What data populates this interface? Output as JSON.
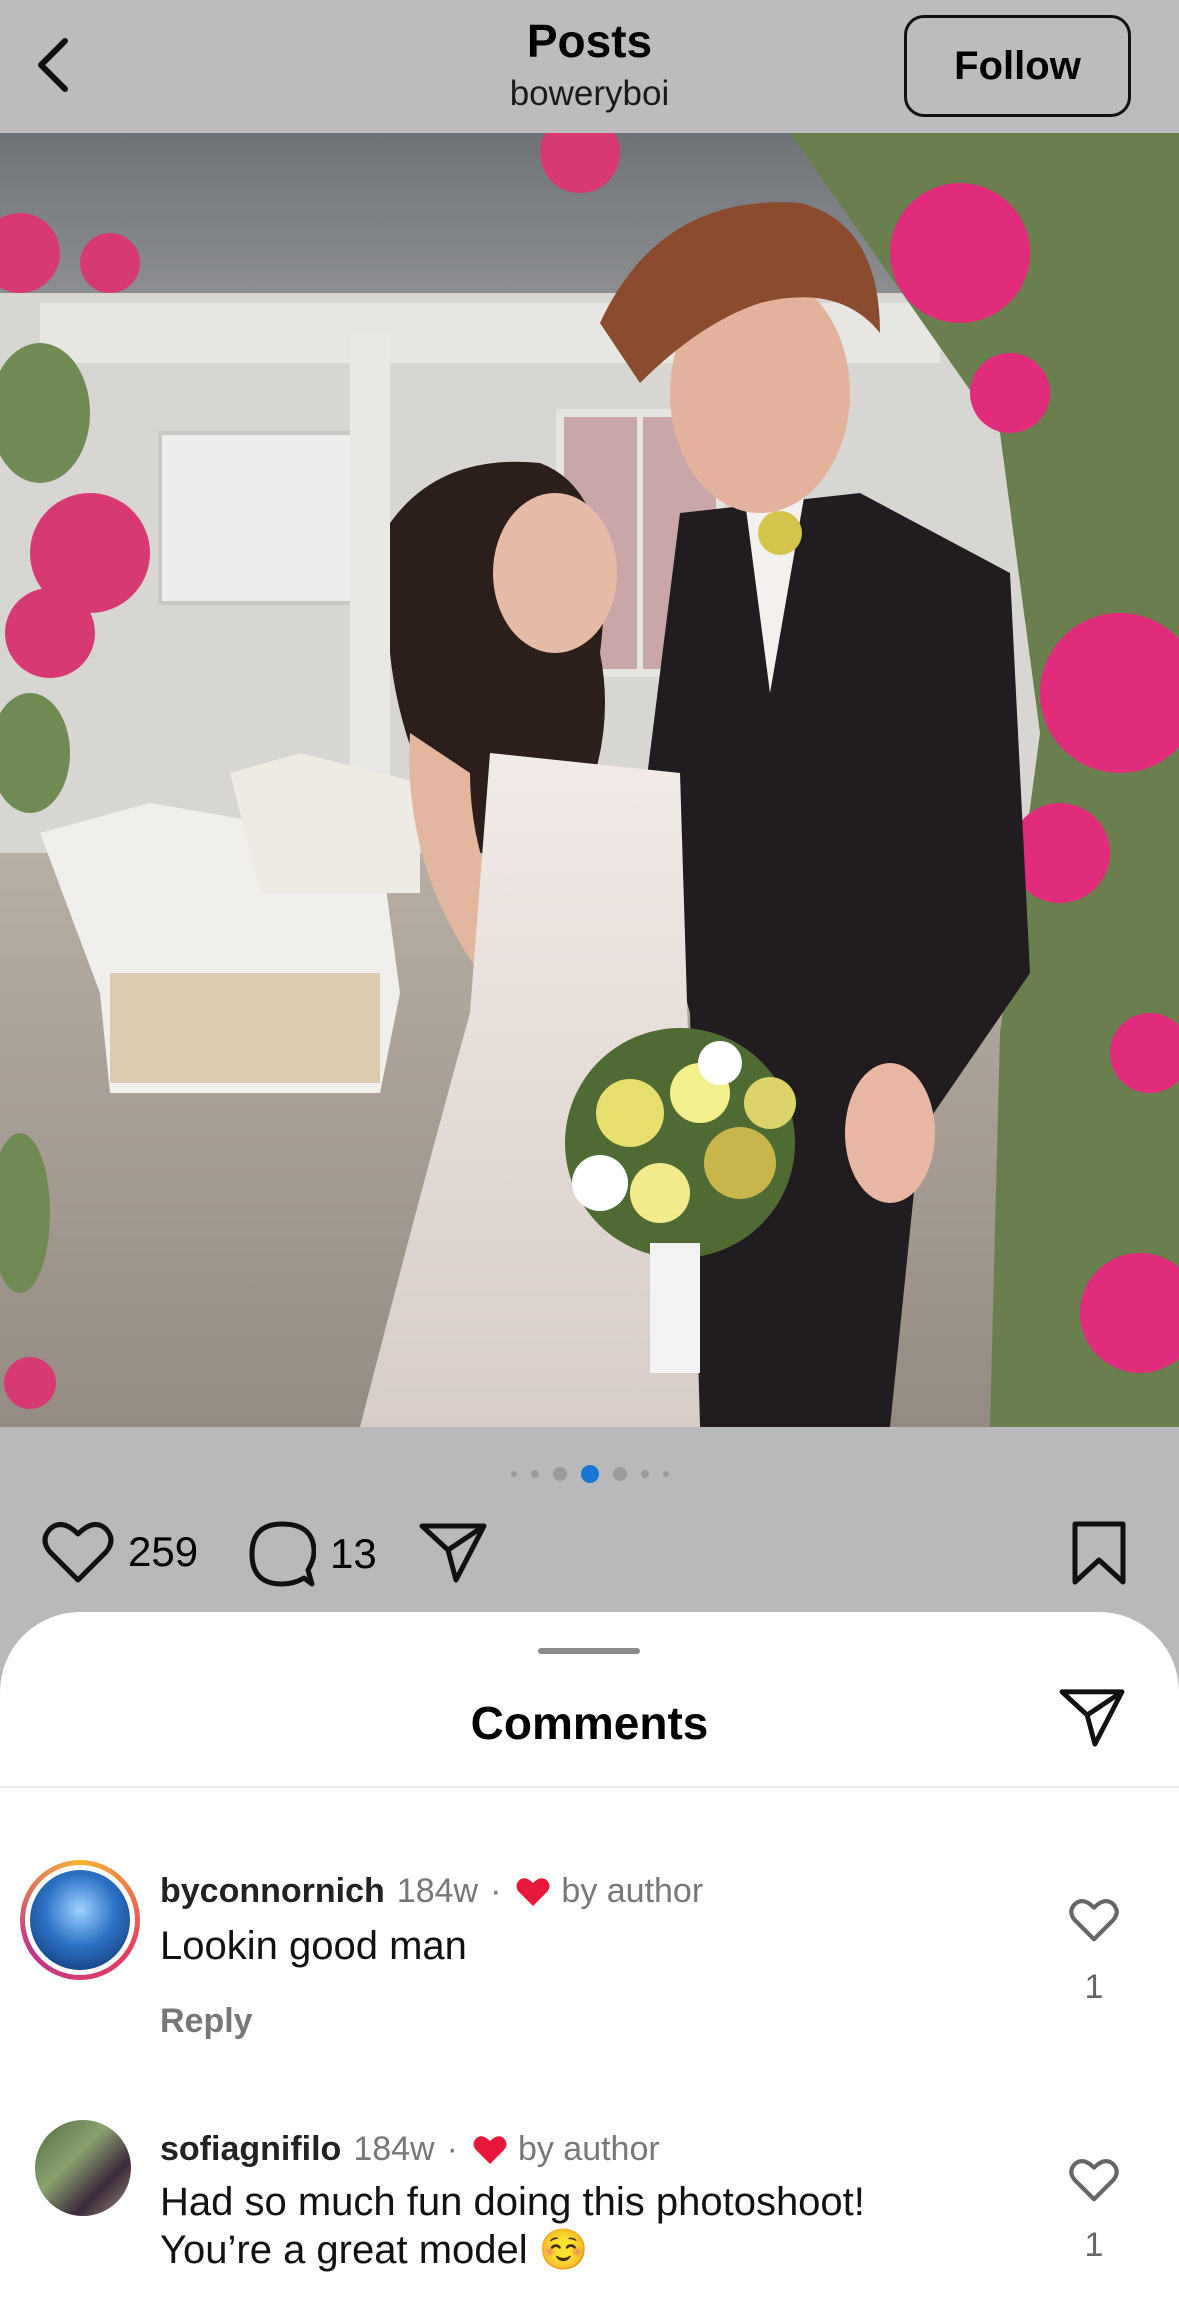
{
  "header": {
    "title": "Posts",
    "subtitle": "boweryboi",
    "follow_label": "Follow"
  },
  "carousel": {
    "dot_count": 7,
    "active_index": 3
  },
  "actions": {
    "likes": "259",
    "comments": "13"
  },
  "sheet": {
    "title": "Comments"
  },
  "comments": [
    {
      "username": "byconnornich",
      "age": "184w",
      "separator": "·",
      "author_like": "by author",
      "text": "Lookin good man",
      "reply_label": "Reply",
      "like_count": "1"
    },
    {
      "username": "sofiagnifilo",
      "age": "184w",
      "separator": "·",
      "author_like": "by author",
      "text_line1": "Had so much fun doing this photoshoot!",
      "text_line2": "You’re a great model ☺️",
      "like_count": "1"
    }
  ],
  "colors": {
    "accent": "#1877d2",
    "heart": "#e8173c",
    "sheet_bg": "#ffffff",
    "overlay": "#b9b9bb"
  }
}
